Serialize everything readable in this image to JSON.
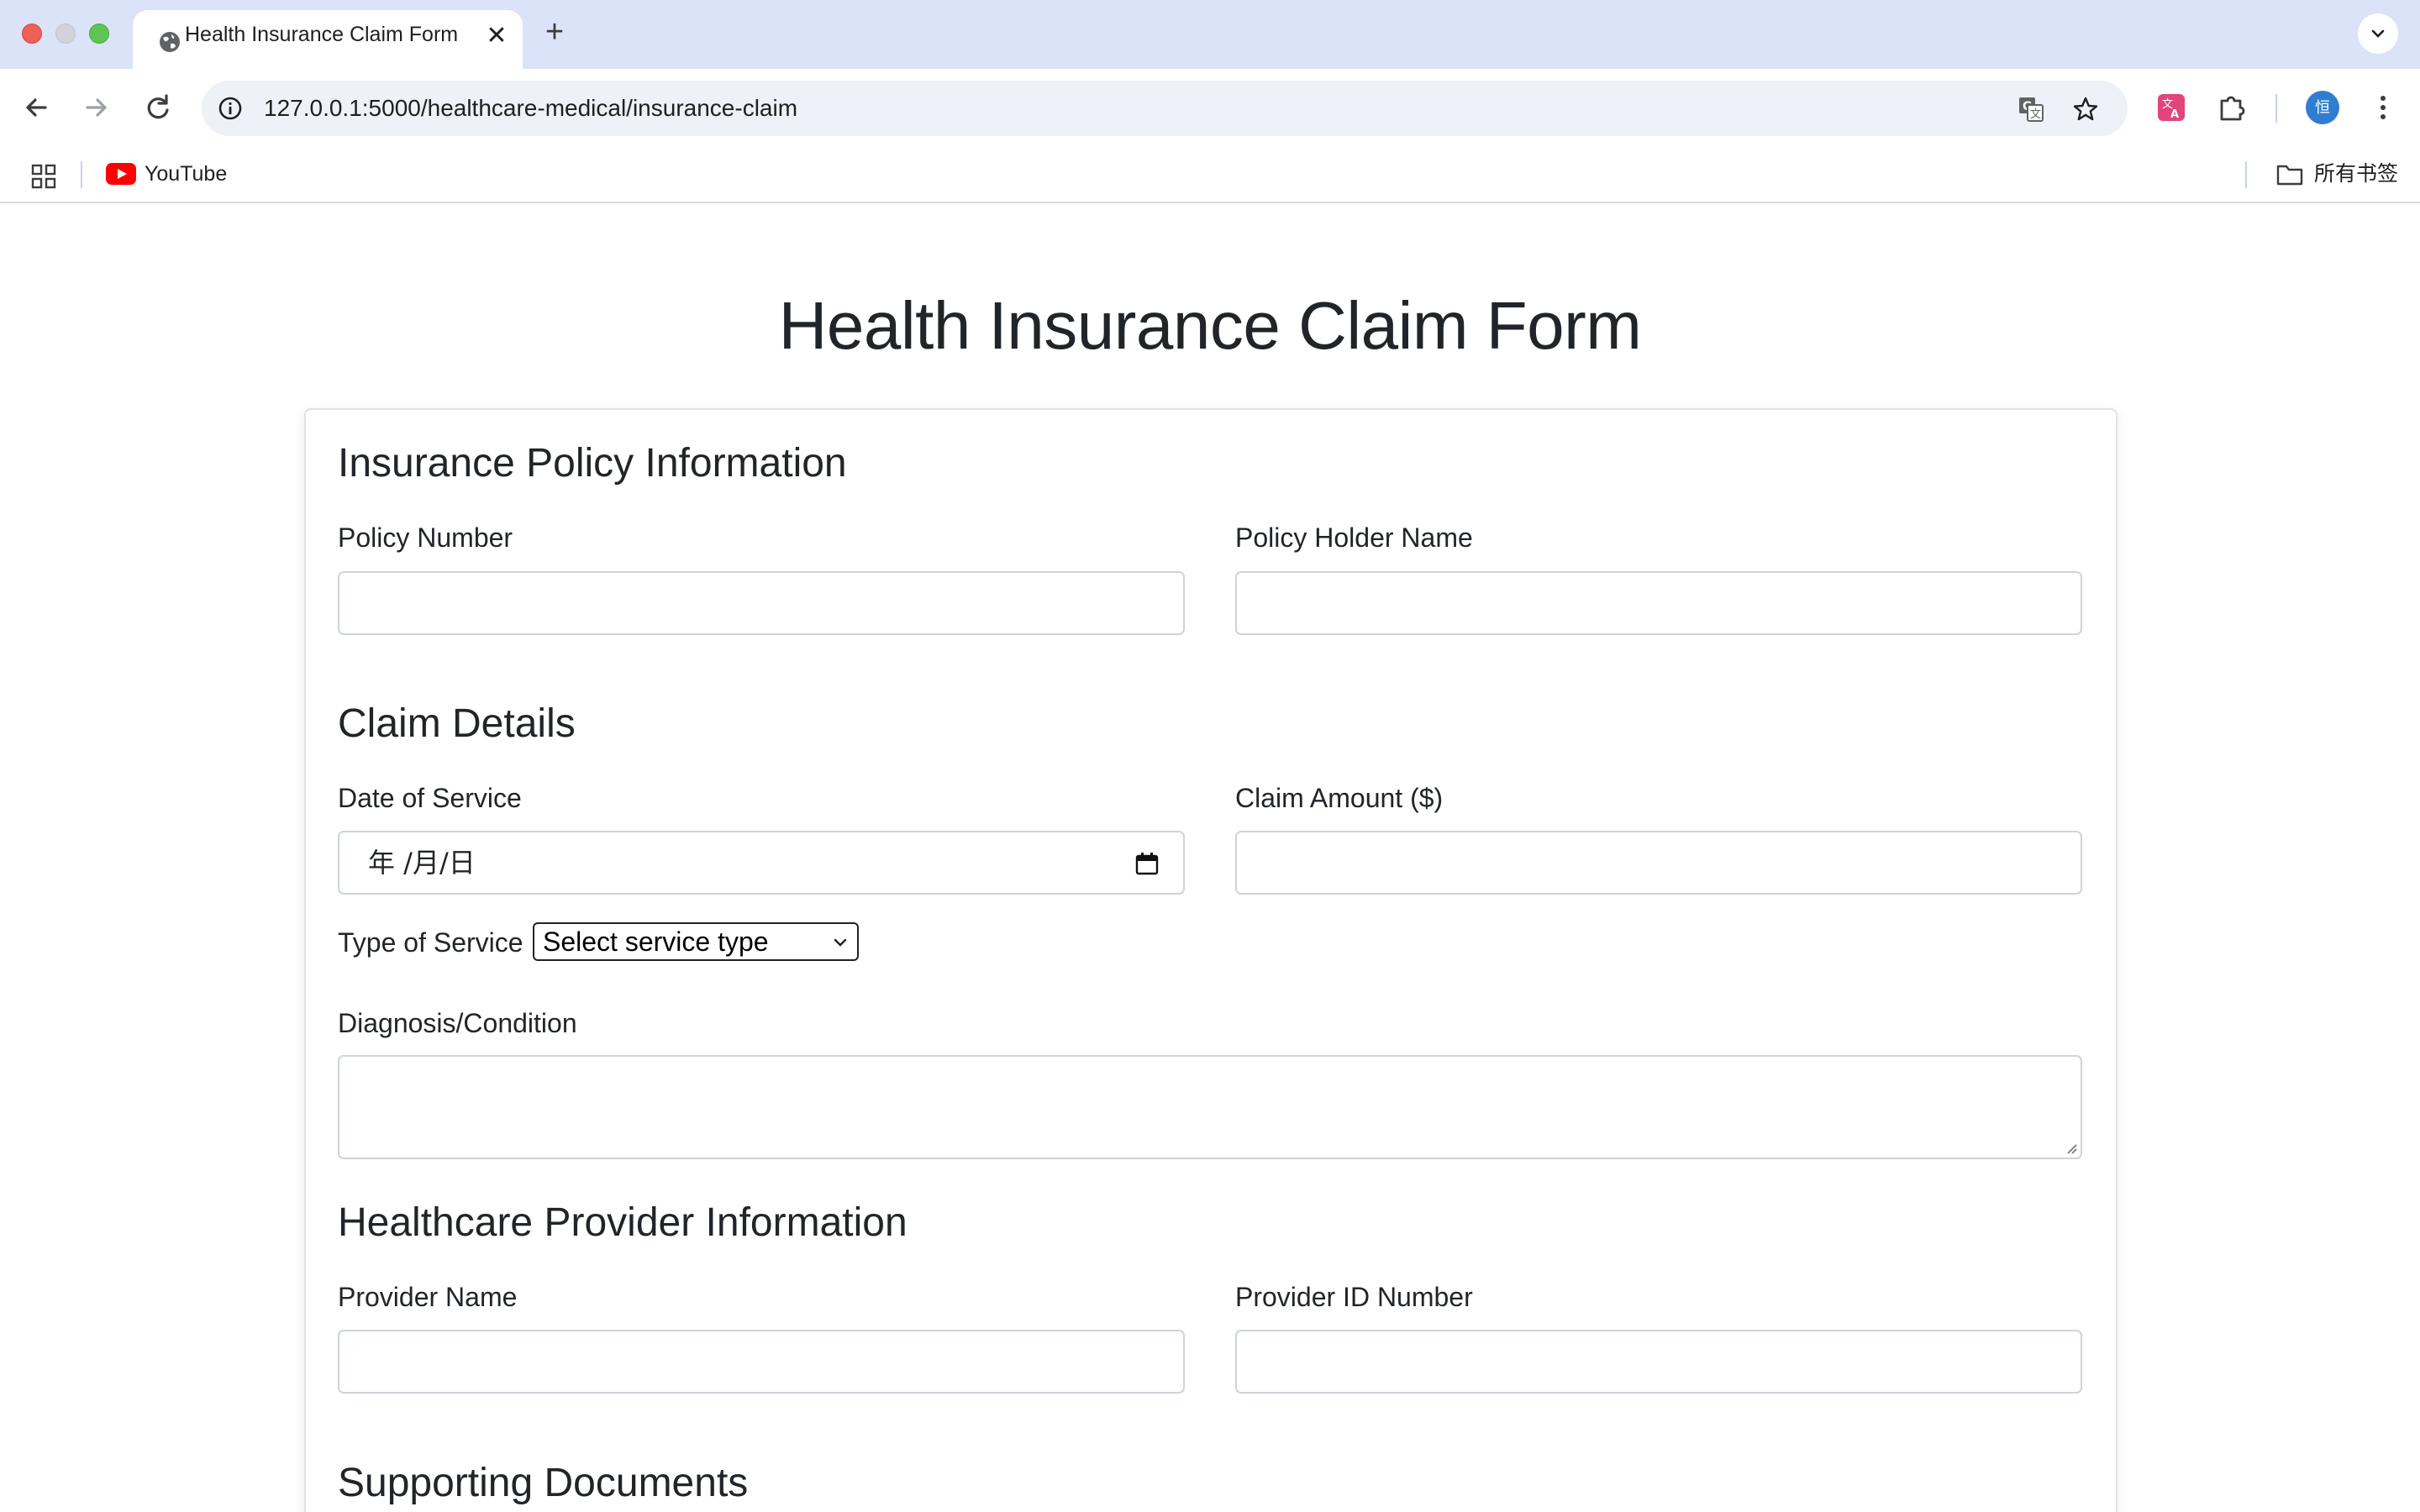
{
  "browser": {
    "tab_title": "Health Insurance Claim Form",
    "tab_close_glyph": "✕",
    "new_tab_glyph": "+",
    "url": "127.0.0.1:5000/healthcare-medical/insurance-claim",
    "profile_initial": "恒",
    "bookmarks": [
      {
        "label": "YouTube",
        "icon": "youtube-icon"
      }
    ],
    "all_bookmarks_label": "所有书签"
  },
  "page": {
    "title": "Health Insurance Claim Form"
  },
  "form": {
    "policy_section": {
      "title": "Insurance Policy Information",
      "policy_number_label": "Policy Number",
      "policy_number_value": "",
      "holder_name_label": "Policy Holder Name",
      "holder_name_value": ""
    },
    "claim_section": {
      "title": "Claim Details",
      "date_label": "Date of Service",
      "date_placeholder": "年 /月/日",
      "amount_label": "Claim Amount ($)",
      "amount_value": "",
      "service_type_label": "Type of Service",
      "service_type_selected": "Select service type",
      "diagnosis_label": "Diagnosis/Condition",
      "diagnosis_value": ""
    },
    "provider_section": {
      "title": "Healthcare Provider Information",
      "provider_name_label": "Provider Name",
      "provider_name_value": "",
      "provider_id_label": "Provider ID Number",
      "provider_id_value": ""
    },
    "documents_section": {
      "title": "Supporting Documents"
    }
  },
  "colors": {
    "tabstrip": "#dbe3f8",
    "omnibox": "#eef1f8",
    "input_border": "#ced4da",
    "text": "#212529"
  }
}
